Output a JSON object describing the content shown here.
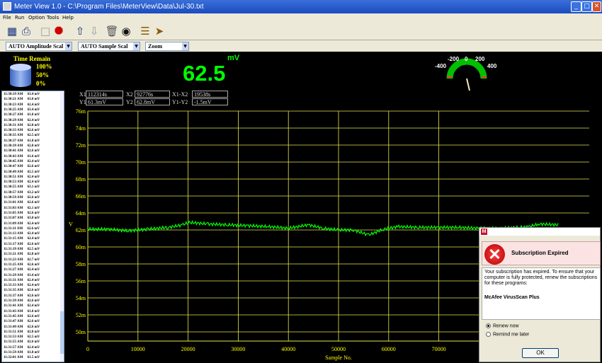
{
  "window": {
    "title": "Meter View 1.0 - C:\\Program Files\\MeterView\\Data\\Jul-30.txt",
    "controls": {
      "minimize": "_",
      "maximize": "□",
      "close": "✕"
    }
  },
  "menu": [
    "File",
    "Run",
    "Option",
    "Tools",
    "Help"
  ],
  "toolbar_icons": [
    "save-icon",
    "print-icon",
    "disabled-chart-icon",
    "stop-icon",
    "upload-arrow-icon",
    "download-arrow-icon",
    "trash-icon",
    "binoculars-icon",
    "books-icon",
    "exit-door-icon"
  ],
  "selectors": {
    "amplitude": "AUTO Amplitude Scal",
    "sample": "AUTO Sample Scal",
    "zoom": "Zoom"
  },
  "time_remain": {
    "label": "Time Remain",
    "levels": [
      "100%",
      "50%",
      "0%"
    ]
  },
  "reading": {
    "value": "62.5",
    "unit": "mV"
  },
  "gauge": {
    "labels": [
      "-400",
      "-200",
      "0",
      "200",
      "400"
    ],
    "needle_value": 62.5
  },
  "cursors": {
    "x1_label": "X1",
    "x1": "112314s",
    "x2_label": "X2",
    "x2": "92776s",
    "dx_label": "X1-X2",
    "dx": "19538s",
    "y1_label": "Y1",
    "y1": "61.3mV",
    "y2_label": "Y2",
    "y2": "62.8mV",
    "dy_label": "Y1-Y2",
    "dy": "-1.5mV"
  },
  "log": [
    {
      "t": "11:30:19 AM",
      "v": "63.4 mV"
    },
    {
      "t": "11:30:21 AM",
      "v": "63.0 mV"
    },
    {
      "t": "11:30:23 AM",
      "v": "62.4 mV"
    },
    {
      "t": "11:30:25 AM",
      "v": "63.4 mV"
    },
    {
      "t": "11:30:27 AM",
      "v": "61.8 mV"
    },
    {
      "t": "11:30:29 AM",
      "v": "62.4 mV"
    },
    {
      "t": "11:30:31 AM",
      "v": "62.8 mV"
    },
    {
      "t": "11:30:33 AM",
      "v": "62.6 mV"
    },
    {
      "t": "11:30:35 AM",
      "v": "62.5 mV"
    },
    {
      "t": "11:30:37 AM",
      "v": "61.8 mV"
    },
    {
      "t": "11:30:39 AM",
      "v": "62.8 mV"
    },
    {
      "t": "11:30:41 AM",
      "v": "62.6 mV"
    },
    {
      "t": "11:30:43 AM",
      "v": "61.6 mV"
    },
    {
      "t": "11:30:45 AM",
      "v": "62.4 mV"
    },
    {
      "t": "11:30:47 AM",
      "v": "62.6 mV"
    },
    {
      "t": "11:30:49 AM",
      "v": "62.5 mV"
    },
    {
      "t": "11:30:51 AM",
      "v": "62.4 mV"
    },
    {
      "t": "11:30:53 AM",
      "v": "62.4 mV"
    },
    {
      "t": "11:30:55 AM",
      "v": "63.1 mV"
    },
    {
      "t": "11:30:57 AM",
      "v": "63.2 mV"
    },
    {
      "t": "11:30:59 AM",
      "v": "62.6 mV"
    },
    {
      "t": "11:31:01 AM",
      "v": "62.6 mV"
    },
    {
      "t": "11:31:03 AM",
      "v": "62.1 mV"
    },
    {
      "t": "11:31:05 AM",
      "v": "62.6 mV"
    },
    {
      "t": "11:31:07 AM",
      "v": "63.0 mV"
    },
    {
      "t": "11:31:09 AM",
      "v": "62.4 mV"
    },
    {
      "t": "11:31:11 AM",
      "v": "62.6 mV"
    },
    {
      "t": "11:31:13 AM",
      "v": "62.4 mV"
    },
    {
      "t": "11:31:15 AM",
      "v": "62.4 mV"
    },
    {
      "t": "11:31:17 AM",
      "v": "62.6 mV"
    },
    {
      "t": "11:31:19 AM",
      "v": "62.5 mV"
    },
    {
      "t": "11:31:21 AM",
      "v": "62.8 mV"
    },
    {
      "t": "11:31:23 AM",
      "v": "62.7 mV"
    },
    {
      "t": "11:31:25 AM",
      "v": "62.6 mV"
    },
    {
      "t": "11:31:27 AM",
      "v": "62.4 mV"
    },
    {
      "t": "11:31:29 AM",
      "v": "63.4 mV"
    },
    {
      "t": "11:31:31 AM",
      "v": "62.4 mV"
    },
    {
      "t": "11:31:33 AM",
      "v": "62.4 mV"
    },
    {
      "t": "11:31:35 AM",
      "v": "62.6 mV"
    },
    {
      "t": "11:31:37 AM",
      "v": "62.6 mV"
    },
    {
      "t": "11:31:39 AM",
      "v": "62.6 mV"
    },
    {
      "t": "11:31:41 AM",
      "v": "62.4 mV"
    },
    {
      "t": "11:31:43 AM",
      "v": "61.8 mV"
    },
    {
      "t": "11:31:45 AM",
      "v": "62.6 mV"
    },
    {
      "t": "11:31:47 AM",
      "v": "62.6 mV"
    },
    {
      "t": "11:31:49 AM",
      "v": "62.6 mV"
    },
    {
      "t": "11:31:51 AM",
      "v": "62.8 mV"
    },
    {
      "t": "11:31:53 AM",
      "v": "62.5 mV"
    },
    {
      "t": "11:31:55 AM",
      "v": "62.6 mV"
    },
    {
      "t": "11:31:57 AM",
      "v": "62.4 mV"
    },
    {
      "t": "11:31:59 AM",
      "v": "61.8 mV"
    },
    {
      "t": "11:32:01 AM",
      "v": "61.5 mV"
    }
  ],
  "chart_data": {
    "type": "line",
    "xlabel": "Sample No.",
    "ylabel": "V",
    "xlim": [
      0,
      100000
    ],
    "ylim": [
      0.05,
      0.07
    ],
    "x_ticks": [
      "0",
      "10000",
      "20000",
      "30000",
      "40000",
      "50000",
      "60000",
      "70000"
    ],
    "y_ticks": [
      "50m",
      "52m",
      "54m",
      "56m",
      "58m",
      "60m",
      "62m",
      "64m",
      "66m",
      "68m",
      "70m",
      "72m",
      "74m",
      "76m"
    ],
    "grid": true,
    "colors": {
      "line": "#00ff00",
      "grid": "#e6e650",
      "axis_text": "#ffff00"
    },
    "series": [
      {
        "x": [
          0,
          4000,
          8000,
          12000,
          16000,
          19000,
          20000,
          24000,
          28000,
          32000,
          36000,
          40000,
          44000,
          47000,
          50000,
          53000,
          56000,
          59000,
          62000,
          66000,
          70000,
          74000,
          78000,
          82000,
          86000,
          88000,
          90000,
          94000
        ],
        "y": [
          0.0621,
          0.0621,
          0.0619,
          0.0621,
          0.0623,
          0.0626,
          0.0629,
          0.0627,
          0.0626,
          0.0625,
          0.0624,
          0.0622,
          0.0626,
          0.0622,
          0.062,
          0.062,
          0.0614,
          0.0621,
          0.0624,
          0.0623,
          0.0623,
          0.0623,
          0.0622,
          0.0622,
          0.0623,
          0.0624,
          0.0627,
          0.0626
        ]
      }
    ]
  },
  "dialog": {
    "app_icon": "M",
    "heading": "Subscription Expired",
    "message": "Your subscription has expired. To ensure that your computer is fully protected, renew the subscriptions for these programs:",
    "product": "McAfee VirusScan Plus",
    "options": [
      "Renew now",
      "Remind me later"
    ],
    "selected_option": "Renew now",
    "ok": "OK"
  }
}
